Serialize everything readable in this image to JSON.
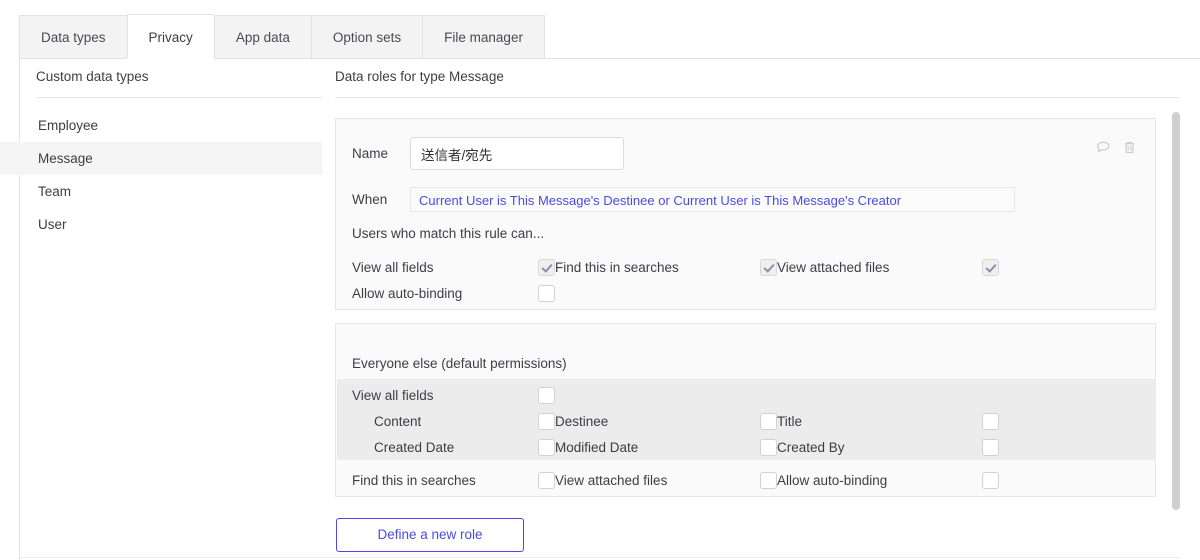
{
  "tabs": [
    {
      "label": "Data types",
      "active": false
    },
    {
      "label": "Privacy",
      "active": true
    },
    {
      "label": "App data",
      "active": false
    },
    {
      "label": "Option sets",
      "active": false
    },
    {
      "label": "File manager",
      "active": false
    }
  ],
  "sidebar": {
    "header": "Custom data types",
    "items": [
      {
        "label": "Employee",
        "selected": false
      },
      {
        "label": "Message",
        "selected": true
      },
      {
        "label": "Team",
        "selected": false
      },
      {
        "label": "User",
        "selected": false
      }
    ]
  },
  "main": {
    "header": "Data roles for type Message",
    "role_panel": {
      "name_label": "Name",
      "name_value": "送信者/宛先",
      "name_placeholder": "",
      "when_label": "When",
      "when_value": "Current User is This Message's Destinee or Current User is This Message's Creator",
      "rule_note": "Users who match this rule can...",
      "permissions": [
        {
          "label": "View all fields",
          "checked": true
        },
        {
          "label": "Find this in searches",
          "checked": true
        },
        {
          "label": "View attached files",
          "checked": true
        },
        {
          "label": "Allow auto-binding",
          "checked": false
        }
      ],
      "comment_icon": "comment-icon",
      "delete_icon": "trash-icon"
    },
    "default_panel": {
      "title": "Everyone else (default permissions)",
      "view_all_fields": {
        "label": "View all fields",
        "checked": false
      },
      "fields": [
        {
          "label": "Content",
          "checked": false
        },
        {
          "label": "Destinee",
          "checked": false
        },
        {
          "label": "Title",
          "checked": false
        },
        {
          "label": "Created Date",
          "checked": false
        },
        {
          "label": "Modified Date",
          "checked": false
        },
        {
          "label": "Created By",
          "checked": false
        }
      ],
      "bottom_permissions": [
        {
          "label": "Find this in searches",
          "checked": false
        },
        {
          "label": "View attached files",
          "checked": false
        },
        {
          "label": "Allow auto-binding",
          "checked": false
        }
      ]
    },
    "define_role_button": "Define a new role"
  },
  "colors": {
    "accent": "#4b4be4",
    "tab_inactive_bg": "#f3f3f3",
    "panel_bg": "#fafafa",
    "shaded_bg": "#ececec",
    "border": "#e6e6e6",
    "text": "#3d3d46",
    "scrollbar": "#cfcfcf"
  }
}
